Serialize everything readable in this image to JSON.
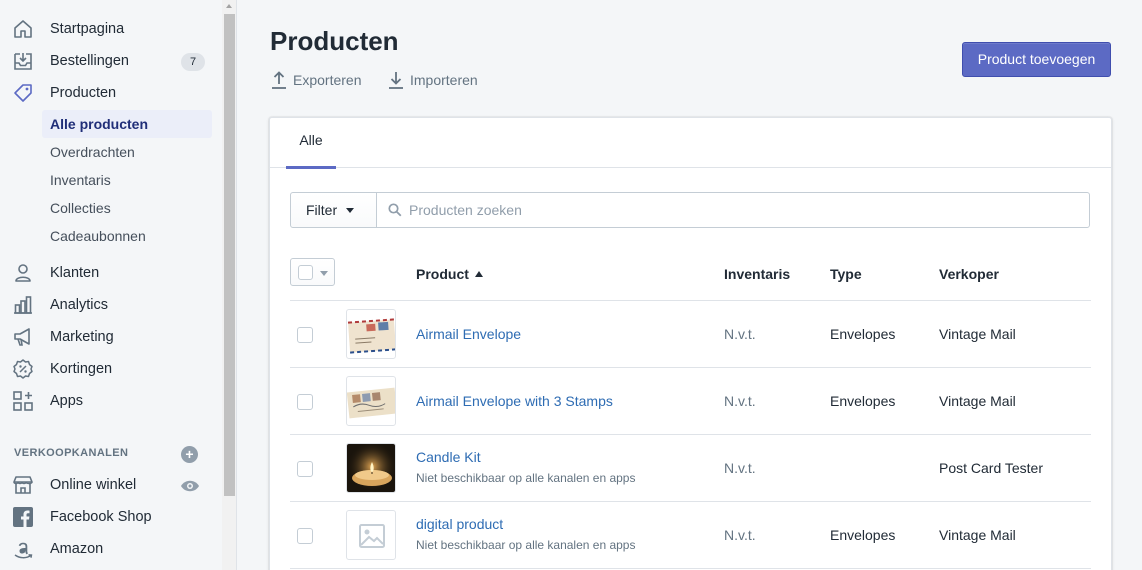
{
  "sidebar": {
    "nav": [
      {
        "label": "Startpagina",
        "icon": "home-icon"
      },
      {
        "label": "Bestellingen",
        "icon": "orders-icon",
        "badge": "7"
      },
      {
        "label": "Producten",
        "icon": "tag-icon"
      }
    ],
    "products_sub": [
      {
        "label": "Alle producten",
        "active": true
      },
      {
        "label": "Overdrachten"
      },
      {
        "label": "Inventaris"
      },
      {
        "label": "Collecties"
      },
      {
        "label": "Cadeaubonnen"
      }
    ],
    "nav2": [
      {
        "label": "Klanten",
        "icon": "customer-icon"
      },
      {
        "label": "Analytics",
        "icon": "bar-chart-icon"
      },
      {
        "label": "Marketing",
        "icon": "megaphone-icon"
      },
      {
        "label": "Kortingen",
        "icon": "discount-icon"
      },
      {
        "label": "Apps",
        "icon": "apps-icon"
      }
    ],
    "channels_title": "VERKOOPKANALEN",
    "channels": [
      {
        "label": "Online winkel",
        "icon": "store-icon"
      },
      {
        "label": "Facebook Shop",
        "icon": "facebook-icon"
      },
      {
        "label": "Amazon",
        "icon": "amazon-icon"
      }
    ]
  },
  "header": {
    "title": "Producten",
    "export_label": "Exporteren",
    "import_label": "Importeren",
    "add_button": "Product toevoegen"
  },
  "tabs": [
    {
      "label": "Alle",
      "active": true
    }
  ],
  "filter": {
    "button_label": "Filter",
    "search_placeholder": "Producten zoeken"
  },
  "table": {
    "columns": [
      "Product",
      "Inventaris",
      "Type",
      "Verkoper"
    ],
    "rows": [
      {
        "name": "Airmail Envelope",
        "sub": "",
        "inventory": "N.v.t.",
        "type": "Envelopes",
        "vendor": "Vintage Mail",
        "thumb": "airmail-envelope"
      },
      {
        "name": "Airmail Envelope with 3 Stamps",
        "sub": "",
        "inventory": "N.v.t.",
        "type": "Envelopes",
        "vendor": "Vintage Mail",
        "thumb": "airmail-envelope-stamps"
      },
      {
        "name": "Candle Kit",
        "sub": "Niet beschikbaar op alle kanalen en apps",
        "inventory": "N.v.t.",
        "type": "",
        "vendor": "Post Card Tester",
        "thumb": "candle"
      },
      {
        "name": "digital product",
        "sub": "Niet beschikbaar op alle kanalen en apps",
        "inventory": "N.v.t.",
        "type": "Envelopes",
        "vendor": "Vintage Mail",
        "thumb": "placeholder"
      }
    ]
  },
  "colors": {
    "primary": "#5c6ac4",
    "link": "#2e6cb3",
    "active_nav_bg": "#ebeef9",
    "active_nav_text": "#202e78"
  }
}
